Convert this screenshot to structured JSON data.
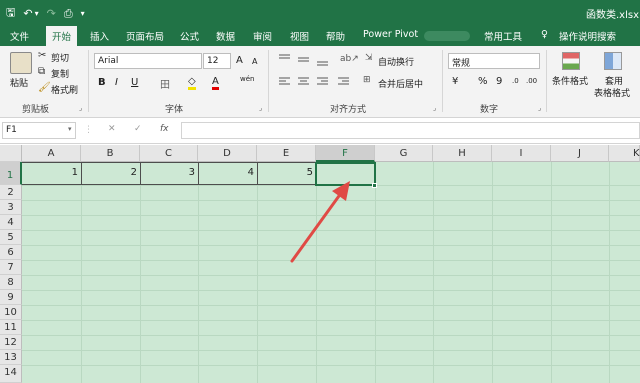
{
  "qat": {
    "save": "🖫",
    "undo": "↶",
    "undo_more": "▾",
    "redo": "↷",
    "print": "⎙",
    "customize": "▾"
  },
  "filename": "函数类.xlsx",
  "tabs": [
    "文件",
    "开始",
    "插入",
    "页面布局",
    "公式",
    "数据",
    "审阅",
    "视图",
    "帮助",
    "Power Pivot",
    "常用工具",
    "操作说明搜索"
  ],
  "search_icon": "♀",
  "clipboard": {
    "paste": "粘贴",
    "cut": "剪切",
    "copy": "复制",
    "format_painter": "格式刷",
    "group": "剪贴板"
  },
  "font": {
    "name": "Arial",
    "size": "12",
    "grow": "A",
    "shrink": "A",
    "bold": "B",
    "italic": "I",
    "underline": "U",
    "border": "田",
    "fill": "◇",
    "color": "A",
    "wen": "wén",
    "group": "字体"
  },
  "alignment": {
    "wrap": "自动换行",
    "merge": "合并后居中",
    "group": "对齐方式"
  },
  "number": {
    "format": "常规",
    "currency": "¥",
    "percent": "%",
    "comma": "9",
    "inc": ".0",
    "dec": ".00",
    "group": "数字"
  },
  "styles": {
    "conditional": "条件格式",
    "table_line1": "套用",
    "table_line2": "表格格式"
  },
  "formula_bar": {
    "name_box": "F1",
    "cancel": "✕",
    "enter": "✓",
    "fx": "fx",
    "value": ""
  },
  "columns": [
    "A",
    "B",
    "C",
    "D",
    "E",
    "F",
    "G",
    "H",
    "I",
    "J",
    "K"
  ],
  "rows": [
    "1",
    "2",
    "3",
    "4",
    "5",
    "6",
    "7",
    "8",
    "9",
    "10",
    "11",
    "12",
    "13",
    "14"
  ],
  "cells": [
    "1",
    "2",
    "3",
    "4",
    "5"
  ],
  "colors": {
    "brand": "#217346",
    "sheet_bg": "#cde8d4",
    "arrow": "#e04a45"
  }
}
